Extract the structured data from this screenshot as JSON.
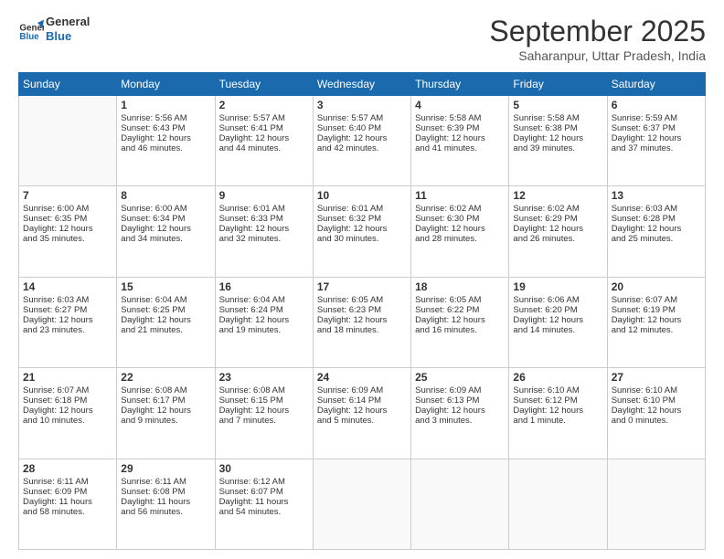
{
  "header": {
    "title": "September 2025",
    "subtitle": "Saharanpur, Uttar Pradesh, India"
  },
  "columns": [
    "Sunday",
    "Monday",
    "Tuesday",
    "Wednesday",
    "Thursday",
    "Friday",
    "Saturday"
  ],
  "weeks": [
    [
      {
        "day": "",
        "info": ""
      },
      {
        "day": "1",
        "info": "Sunrise: 5:56 AM\nSunset: 6:43 PM\nDaylight: 12 hours\nand 46 minutes."
      },
      {
        "day": "2",
        "info": "Sunrise: 5:57 AM\nSunset: 6:41 PM\nDaylight: 12 hours\nand 44 minutes."
      },
      {
        "day": "3",
        "info": "Sunrise: 5:57 AM\nSunset: 6:40 PM\nDaylight: 12 hours\nand 42 minutes."
      },
      {
        "day": "4",
        "info": "Sunrise: 5:58 AM\nSunset: 6:39 PM\nDaylight: 12 hours\nand 41 minutes."
      },
      {
        "day": "5",
        "info": "Sunrise: 5:58 AM\nSunset: 6:38 PM\nDaylight: 12 hours\nand 39 minutes."
      },
      {
        "day": "6",
        "info": "Sunrise: 5:59 AM\nSunset: 6:37 PM\nDaylight: 12 hours\nand 37 minutes."
      }
    ],
    [
      {
        "day": "7",
        "info": "Sunrise: 6:00 AM\nSunset: 6:35 PM\nDaylight: 12 hours\nand 35 minutes."
      },
      {
        "day": "8",
        "info": "Sunrise: 6:00 AM\nSunset: 6:34 PM\nDaylight: 12 hours\nand 34 minutes."
      },
      {
        "day": "9",
        "info": "Sunrise: 6:01 AM\nSunset: 6:33 PM\nDaylight: 12 hours\nand 32 minutes."
      },
      {
        "day": "10",
        "info": "Sunrise: 6:01 AM\nSunset: 6:32 PM\nDaylight: 12 hours\nand 30 minutes."
      },
      {
        "day": "11",
        "info": "Sunrise: 6:02 AM\nSunset: 6:30 PM\nDaylight: 12 hours\nand 28 minutes."
      },
      {
        "day": "12",
        "info": "Sunrise: 6:02 AM\nSunset: 6:29 PM\nDaylight: 12 hours\nand 26 minutes."
      },
      {
        "day": "13",
        "info": "Sunrise: 6:03 AM\nSunset: 6:28 PM\nDaylight: 12 hours\nand 25 minutes."
      }
    ],
    [
      {
        "day": "14",
        "info": "Sunrise: 6:03 AM\nSunset: 6:27 PM\nDaylight: 12 hours\nand 23 minutes."
      },
      {
        "day": "15",
        "info": "Sunrise: 6:04 AM\nSunset: 6:25 PM\nDaylight: 12 hours\nand 21 minutes."
      },
      {
        "day": "16",
        "info": "Sunrise: 6:04 AM\nSunset: 6:24 PM\nDaylight: 12 hours\nand 19 minutes."
      },
      {
        "day": "17",
        "info": "Sunrise: 6:05 AM\nSunset: 6:23 PM\nDaylight: 12 hours\nand 18 minutes."
      },
      {
        "day": "18",
        "info": "Sunrise: 6:05 AM\nSunset: 6:22 PM\nDaylight: 12 hours\nand 16 minutes."
      },
      {
        "day": "19",
        "info": "Sunrise: 6:06 AM\nSunset: 6:20 PM\nDaylight: 12 hours\nand 14 minutes."
      },
      {
        "day": "20",
        "info": "Sunrise: 6:07 AM\nSunset: 6:19 PM\nDaylight: 12 hours\nand 12 minutes."
      }
    ],
    [
      {
        "day": "21",
        "info": "Sunrise: 6:07 AM\nSunset: 6:18 PM\nDaylight: 12 hours\nand 10 minutes."
      },
      {
        "day": "22",
        "info": "Sunrise: 6:08 AM\nSunset: 6:17 PM\nDaylight: 12 hours\nand 9 minutes."
      },
      {
        "day": "23",
        "info": "Sunrise: 6:08 AM\nSunset: 6:15 PM\nDaylight: 12 hours\nand 7 minutes."
      },
      {
        "day": "24",
        "info": "Sunrise: 6:09 AM\nSunset: 6:14 PM\nDaylight: 12 hours\nand 5 minutes."
      },
      {
        "day": "25",
        "info": "Sunrise: 6:09 AM\nSunset: 6:13 PM\nDaylight: 12 hours\nand 3 minutes."
      },
      {
        "day": "26",
        "info": "Sunrise: 6:10 AM\nSunset: 6:12 PM\nDaylight: 12 hours\nand 1 minute."
      },
      {
        "day": "27",
        "info": "Sunrise: 6:10 AM\nSunset: 6:10 PM\nDaylight: 12 hours\nand 0 minutes."
      }
    ],
    [
      {
        "day": "28",
        "info": "Sunrise: 6:11 AM\nSunset: 6:09 PM\nDaylight: 11 hours\nand 58 minutes."
      },
      {
        "day": "29",
        "info": "Sunrise: 6:11 AM\nSunset: 6:08 PM\nDaylight: 11 hours\nand 56 minutes."
      },
      {
        "day": "30",
        "info": "Sunrise: 6:12 AM\nSunset: 6:07 PM\nDaylight: 11 hours\nand 54 minutes."
      },
      {
        "day": "",
        "info": ""
      },
      {
        "day": "",
        "info": ""
      },
      {
        "day": "",
        "info": ""
      },
      {
        "day": "",
        "info": ""
      }
    ]
  ]
}
